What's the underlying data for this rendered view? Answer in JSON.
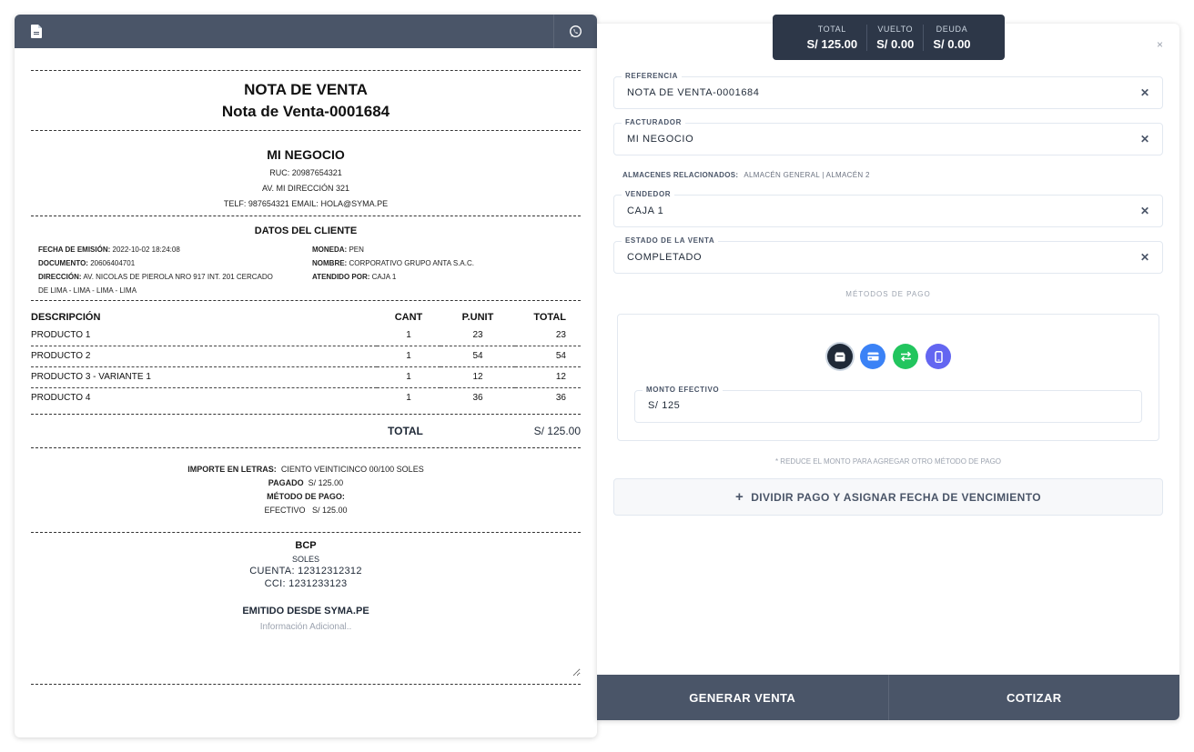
{
  "receipt": {
    "header": {
      "left_icon": "document-icon",
      "right_icon": "whatsapp-icon"
    },
    "doc_type": "NOTA DE VENTA",
    "doc_number": "Nota de Venta-0001684",
    "business": {
      "name": "MI NEGOCIO",
      "ruc": "RUC: 20987654321",
      "address": "AV. MI DIRECCIÓN 321",
      "contact": "TELF: 987654321 EMAIL: HOLA@SYMA.PE"
    },
    "client": {
      "section_title": "DATOS DEL CLIENTE",
      "fecha_label": "FECHA DE EMISIÓN:",
      "fecha": "2022-10-02 18:24:08",
      "documento_label": "DOCUMENTO:",
      "documento": "20606404701",
      "direccion_label": "DIRECCIÓN:",
      "direccion": "AV. NICOLAS DE PIEROLA NRO 917 INT. 201 CERCADO",
      "direccion2": "DE LIMA - LIMA - LIMA - LIMA",
      "moneda_label": "MONEDA:",
      "moneda": "PEN",
      "nombre_label": "NOMBRE:",
      "nombre": "CORPORATIVO GRUPO ANTA S.A.C.",
      "atendido_label": "ATENDIDO POR:",
      "atendido": "CAJA 1"
    },
    "table": {
      "headers": {
        "desc": "DESCRIPCIÓN",
        "cant": "CANT",
        "punit": "P.UNIT",
        "total": "TOTAL"
      },
      "rows": [
        {
          "desc": "PRODUCTO 1",
          "cant": "1",
          "punit": "23",
          "total": "23"
        },
        {
          "desc": "PRODUCTO 2",
          "cant": "1",
          "punit": "54",
          "total": "54"
        },
        {
          "desc": "PRODUCTO 3 - VARIANTE 1",
          "cant": "1",
          "punit": "12",
          "total": "12"
        },
        {
          "desc": "PRODUCTO 4",
          "cant": "1",
          "punit": "36",
          "total": "36"
        }
      ]
    },
    "total_label": "TOTAL",
    "total_value": "S/ 125.00",
    "importe_label": "IMPORTE EN LETRAS:",
    "importe": "CIENTO VEINTICINCO 00/100 SOLES",
    "pagado_label": "PAGADO",
    "pagado": "S/ 125.00",
    "metodo_label": "MÉTODO DE PAGO:",
    "metodo": "EFECTIVO",
    "metodo_monto": "S/ 125.00",
    "bank": {
      "name": "BCP",
      "currency": "SOLES",
      "cuenta": "CUENTA: 12312312312",
      "cci": "CCI: 1231233123"
    },
    "emitido": "EMITIDO DESDE SYMA.PE",
    "info_placeholder": "Información Adicional.."
  },
  "summary": {
    "total_label": "TOTAL",
    "total": "S/ 125.00",
    "vuelto_label": "VUELTO",
    "vuelto": "S/ 0.00",
    "deuda_label": "DEUDA",
    "deuda": "S/ 0.00"
  },
  "form": {
    "close": "×",
    "referencia_label": "REFERENCIA",
    "referencia": "NOTA DE VENTA-0001684",
    "facturador_label": "FACTURADOR",
    "facturador": "MI NEGOCIO",
    "almacenes_label": "ALMACENES RELACIONADOS:",
    "almacenes": "ALMACÉN GENERAL | ALMACÉN 2",
    "vendedor_label": "VENDEDOR",
    "vendedor": "CAJA 1",
    "estado_label": "ESTADO DE LA VENTA",
    "estado": "COMPLETADO",
    "clear_symbol": "✕",
    "metodos_label": "MÉTODOS DE PAGO",
    "payment_methods": [
      {
        "icon": "cash-icon",
        "color": "#1f2937"
      },
      {
        "icon": "credit-card-icon",
        "color": "#3b82f6"
      },
      {
        "icon": "transfer-icon",
        "color": "#22c55e"
      },
      {
        "icon": "mobile-icon",
        "color": "#6366f1"
      }
    ],
    "monto_label": "MONTO EFECTIVO",
    "monto_value": "S/ 125",
    "reduce_note": "* REDUCE EL MONTO PARA AGREGAR OTRO MÉTODO DE PAGO",
    "dividir_plus": "+",
    "dividir_label": "DIVIDIR PAGO Y ASIGNAR FECHA DE VENCIMIENTO"
  },
  "footer": {
    "generar": "GENERAR VENTA",
    "cotizar": "COTIZAR"
  },
  "colors": {
    "header": "#4a5568",
    "summary_bg": "#2d3748"
  }
}
